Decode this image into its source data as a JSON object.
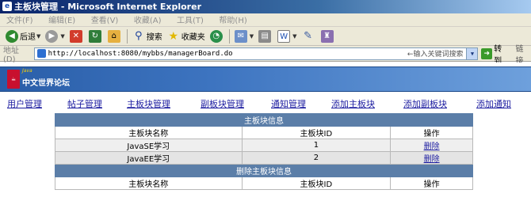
{
  "window": {
    "title": "主板块管理 - Microsoft Internet Explorer"
  },
  "menu": [
    "文件(F)",
    "编辑(E)",
    "查看(V)",
    "收藏(A)",
    "工具(T)",
    "帮助(H)"
  ],
  "toolbar": {
    "back_label": "后退",
    "search_label": "搜索",
    "favorites_label": "收藏夹"
  },
  "address": {
    "label": "地址(D)",
    "url": "http://localhost:8080/mybbs/managerBoard.do",
    "hint": "←输入关键词搜索",
    "go_label": "转到",
    "links_label": "链接"
  },
  "site": {
    "logo_text": "中文世界论坛",
    "logo_tag": "Java"
  },
  "nav": [
    "用户管理",
    "帖子管理",
    "主板块管理",
    "副板块管理",
    "通知管理",
    "添加主板块",
    "添加副板块",
    "添加通知"
  ],
  "main_table": {
    "caption": "主板块信息",
    "headers": [
      "主板块名称",
      "主板块ID",
      "操作"
    ],
    "rows": [
      {
        "name": "JavaSE学习",
        "id": "1",
        "action": "删除"
      },
      {
        "name": "JavaEE学习",
        "id": "2",
        "action": "删除"
      }
    ]
  },
  "delete_table": {
    "caption": "删除主板块信息",
    "headers": [
      "主板块名称",
      "主板块ID",
      "操作"
    ]
  }
}
